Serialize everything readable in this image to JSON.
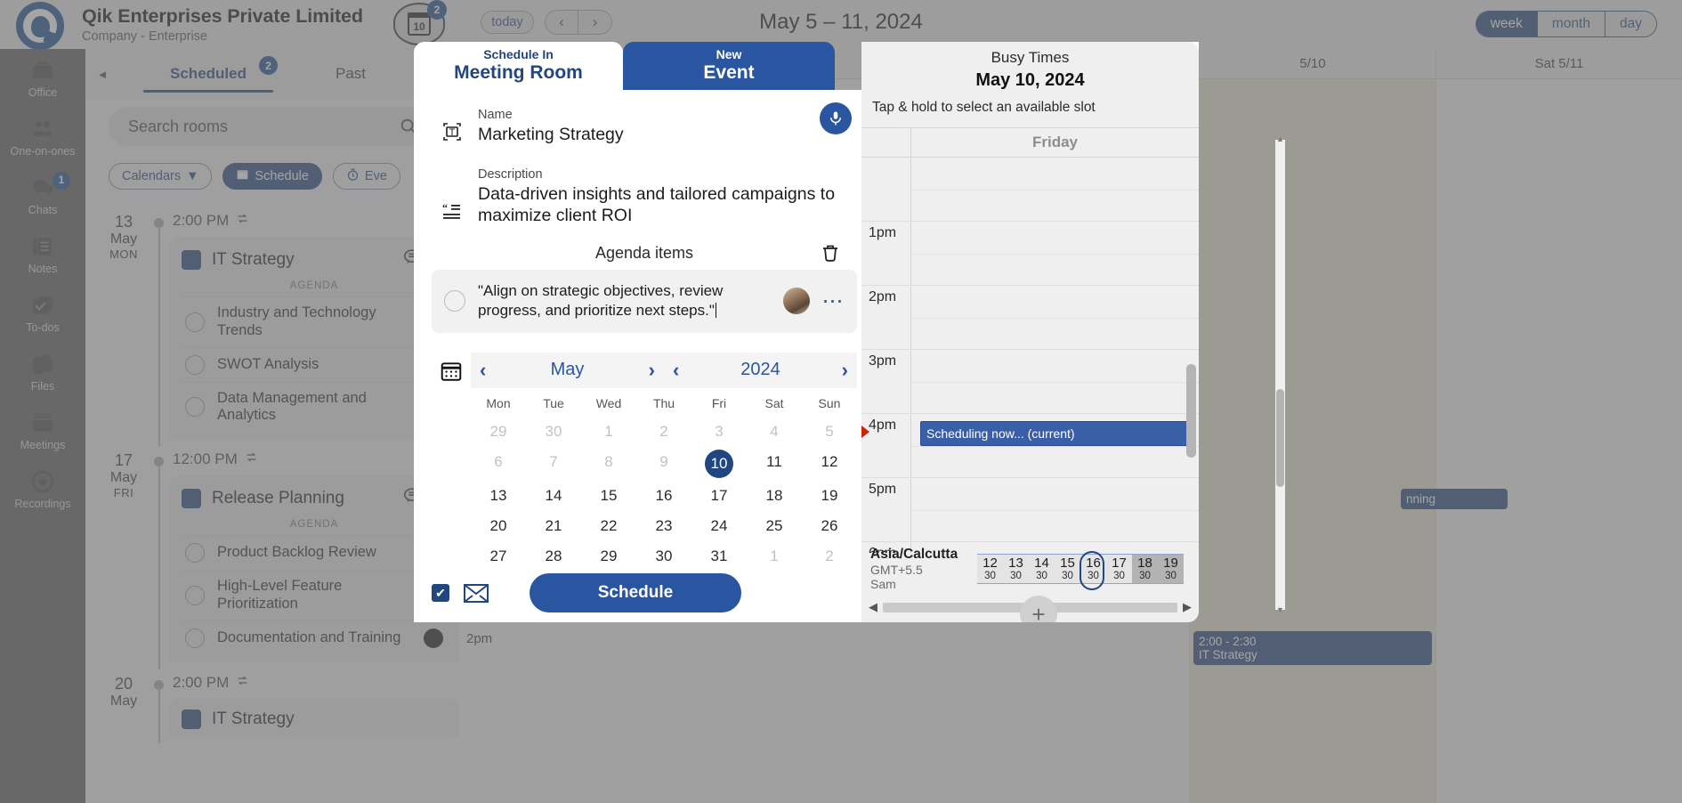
{
  "topbar": {
    "org_name": "Qik Enterprises Private Limited",
    "org_sub": "Company - Enterprise",
    "date_chip_day": "10",
    "date_chip_badge": "2",
    "today_label": "today",
    "prev_label": "‹",
    "next_label": "›",
    "range_title": "May 5 – 11, 2024",
    "views": [
      {
        "label": "week",
        "active": true
      },
      {
        "label": "month",
        "active": false
      },
      {
        "label": "day",
        "active": false
      }
    ]
  },
  "rail": {
    "items": [
      {
        "label": "Office",
        "icon": "briefcase-icon",
        "badge": ""
      },
      {
        "label": "One-on-ones",
        "icon": "people-icon",
        "badge": ""
      },
      {
        "label": "Chats",
        "icon": "chat-bubbles-icon",
        "badge": "1"
      },
      {
        "label": "Notes",
        "icon": "notes-icon",
        "badge": ""
      },
      {
        "label": "To-dos",
        "icon": "checkbox-stack-icon",
        "badge": ""
      },
      {
        "label": "Files",
        "icon": "files-icon",
        "badge": ""
      },
      {
        "label": "Meetings",
        "icon": "meetings-icon",
        "badge": ""
      },
      {
        "label": "Recordings",
        "icon": "record-circle-icon",
        "badge": ""
      }
    ]
  },
  "leftpane": {
    "tabs": [
      {
        "label": "Scheduled",
        "badge": "2",
        "active": true
      },
      {
        "label": "Past",
        "badge": "",
        "active": false
      }
    ],
    "search_placeholder": "Search rooms",
    "filters": [
      {
        "label": "Calendars",
        "caret": "▼",
        "solid": false,
        "icon": ""
      },
      {
        "label": "Schedule",
        "caret": "",
        "solid": true,
        "icon": "calendar-icon"
      },
      {
        "label": "Eve",
        "caret": "",
        "solid": false,
        "icon": "timer-icon"
      }
    ],
    "groups": [
      {
        "day": "13",
        "month": "May",
        "weekday": "MON",
        "time": "2:00 PM",
        "repeat_icon": "repeat-icon",
        "title": "IT Strategy",
        "agenda_label": "AGENDA",
        "agenda": [
          "Industry and Technology Trends",
          "SWOT Analysis",
          "Data Management and Analytics"
        ]
      },
      {
        "day": "17",
        "month": "May",
        "weekday": "FRI",
        "time": "12:00 PM",
        "repeat_icon": "repeat-icon",
        "title": "Release Planning",
        "agenda_label": "AGENDA",
        "agenda": [
          "Product Backlog Review",
          "High-Level Feature Prioritization",
          "Documentation and Training"
        ]
      },
      {
        "day": "20",
        "month": "May",
        "weekday": "",
        "time": "2:00 PM",
        "repeat_icon": "repeat-icon",
        "title": "IT Strategy",
        "agenda_label": "",
        "agenda": []
      }
    ]
  },
  "rightgrid": {
    "columns": [
      "5/10",
      "Sat 5/11"
    ],
    "hours": [
      "2pm"
    ],
    "events": [
      {
        "time": "2:00 - 2:30",
        "title": "IT Strategy"
      },
      {
        "title": "nning"
      }
    ]
  },
  "modal": {
    "tab_left_small": "Schedule In",
    "tab_left_big": "Meeting Room",
    "tab_right_small": "New",
    "tab_right_big": "Event",
    "close_icon": "close-icon",
    "name_label": "Name",
    "name_value": "Marketing Strategy",
    "name_icon": "text-field-icon",
    "mic_icon": "microphone-icon",
    "description_label": "Description",
    "description_value": "Data-driven insights and tailored campaigns to maximize client ROI",
    "description_icon": "quote-icon",
    "agenda_heading": "Agenda items",
    "agenda_trash_icon": "trash-icon",
    "agenda_item_text": "\"Align on strategic objectives, review progress, and prioritize next steps.\"",
    "agenda_item_avatar": "user-avatar",
    "agenda_item_more_icon": "more-options-icon",
    "datepicker": {
      "calendar_icon": "calendar-picker-icon",
      "month": "May",
      "year": "2024",
      "prev_month_icon": "chevron-left-icon",
      "next_month_icon": "chevron-right-icon",
      "prev_year_icon": "chevron-left-icon",
      "next_year_icon": "chevron-right-icon",
      "weekdays": [
        "Mon",
        "Tue",
        "Wed",
        "Thu",
        "Fri",
        "Sat",
        "Sun"
      ],
      "weeks": [
        [
          {
            "d": "29",
            "mut": true
          },
          {
            "d": "30",
            "mut": true
          },
          {
            "d": "1",
            "mut": true
          },
          {
            "d": "2",
            "mut": true
          },
          {
            "d": "3",
            "mut": true
          },
          {
            "d": "4",
            "mut": true
          },
          {
            "d": "5",
            "mut": true
          }
        ],
        [
          {
            "d": "6",
            "mut": true
          },
          {
            "d": "7",
            "mut": true
          },
          {
            "d": "8",
            "mut": true
          },
          {
            "d": "9",
            "mut": true
          },
          {
            "d": "10",
            "sel": true
          },
          {
            "d": "11"
          },
          {
            "d": "12"
          }
        ],
        [
          {
            "d": "13"
          },
          {
            "d": "14"
          },
          {
            "d": "15"
          },
          {
            "d": "16"
          },
          {
            "d": "17"
          },
          {
            "d": "18"
          },
          {
            "d": "19"
          }
        ],
        [
          {
            "d": "20"
          },
          {
            "d": "21"
          },
          {
            "d": "22"
          },
          {
            "d": "23"
          },
          {
            "d": "24"
          },
          {
            "d": "25"
          },
          {
            "d": "26"
          }
        ],
        [
          {
            "d": "27"
          },
          {
            "d": "28"
          },
          {
            "d": "29"
          },
          {
            "d": "30"
          },
          {
            "d": "31"
          },
          {
            "d": "1",
            "mut": true
          },
          {
            "d": "2",
            "mut": true
          }
        ]
      ]
    },
    "footer": {
      "checkbox_checked": "✔",
      "email_icon": "envelope-icon",
      "schedule_label": "Schedule"
    }
  },
  "busy": {
    "title": "Busy Times",
    "date": "May 10, 2024",
    "hint": "Tap & hold to select an available slot",
    "day_header": "Friday",
    "hours": [
      "",
      "1pm",
      "2pm",
      "3pm",
      "4pm",
      "5pm",
      "6pm"
    ],
    "events": [
      {
        "label": "Scheduling now... (current)"
      }
    ],
    "timezone": {
      "name": "Asia/Calcutta",
      "offset": "GMT+5.5",
      "person": "Sam"
    },
    "hour_slots": [
      {
        "h": "12",
        "m": "30",
        "state": "free"
      },
      {
        "h": "13",
        "m": "30",
        "state": "free"
      },
      {
        "h": "14",
        "m": "30",
        "state": "free"
      },
      {
        "h": "15",
        "m": "30",
        "state": "free"
      },
      {
        "h": "16",
        "m": "30",
        "state": "free",
        "selected": true
      },
      {
        "h": "17",
        "m": "30",
        "state": "free"
      },
      {
        "h": "18",
        "m": "30",
        "state": "busy"
      },
      {
        "h": "19",
        "m": "30",
        "state": "busy"
      }
    ],
    "add_icon": "plus-icon",
    "scroll_left_icon": "caret-left-icon",
    "scroll_right_icon": "caret-right-icon"
  },
  "colors": {
    "brand_blue": "#22467f",
    "accent_blue": "#2a55a0",
    "panel_gray": "#efefef"
  }
}
